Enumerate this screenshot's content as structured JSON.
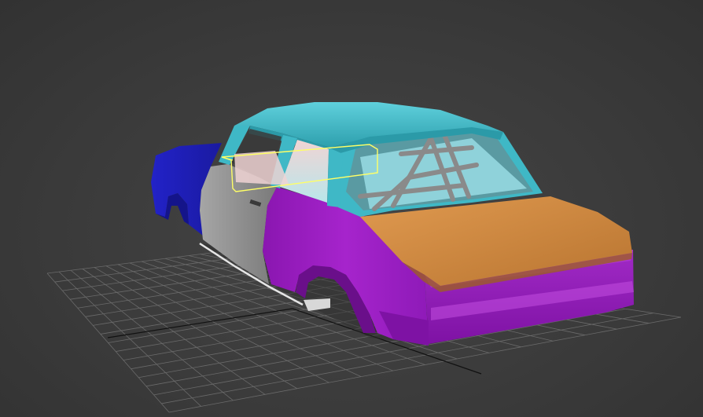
{
  "viewport": {
    "background": "#3d3d3d",
    "grid_color": "#6a6a6a",
    "axis_color": "#101010"
  },
  "model": {
    "body_colors": {
      "roof": "#3fb8c6",
      "front_fender": "#1f1fb8",
      "door": "#8f8f8f",
      "rear_quarter": "#9a1fc0",
      "trunk_lid": "#d08a40",
      "roll_cage": "#8a8a8a",
      "interior": "#e8c8c8"
    },
    "selection_color": "#ffff66"
  }
}
